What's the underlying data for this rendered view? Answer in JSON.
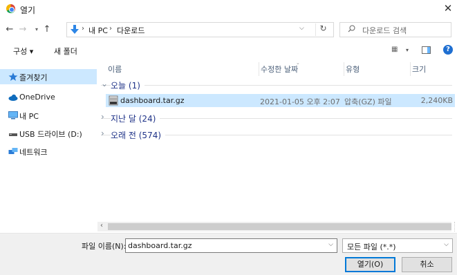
{
  "window": {
    "title": "열기",
    "close_glyph": "✕"
  },
  "nav": {
    "back": "←",
    "forward": "→",
    "recent": "▾",
    "up": "↑"
  },
  "address": {
    "crumbs": [
      "내 PC",
      "다운로드"
    ],
    "separator": "›",
    "dropdown": "⌵",
    "refresh": "↻"
  },
  "search": {
    "placeholder": "다운로드 검색"
  },
  "toolbar": {
    "organize_label": "구성 ▾",
    "new_folder_label": "새 폴더",
    "view_glyph": "▦",
    "view_dropdown": "▾",
    "help_glyph": "?"
  },
  "sidebar": {
    "items": [
      {
        "label": "즐겨찾기",
        "icon": "star-icon",
        "selected": true
      },
      {
        "label": "OneDrive",
        "icon": "cloud-icon"
      },
      {
        "label": "내 PC",
        "icon": "computer-icon"
      },
      {
        "label": "USB 드라이브 (D:)",
        "icon": "usb-drive-icon"
      },
      {
        "label": "네트워크",
        "icon": "network-icon"
      }
    ]
  },
  "columns": {
    "name": "이름",
    "date": "수정한 날짜",
    "type": "유형",
    "size": "크기",
    "sort_glyph": "⌄"
  },
  "groups": [
    {
      "label": "오늘 (1)",
      "expanded": true,
      "chevron": "⌄"
    },
    {
      "label": "지난 달 (24)",
      "expanded": false,
      "chevron": "›"
    },
    {
      "label": "오래 전 (574)",
      "expanded": false,
      "chevron": "›"
    }
  ],
  "files": [
    {
      "name": "dashboard.tar.gz",
      "date": "2021-01-05 오후 2:07",
      "type": "압축(GZ) 파일",
      "size": "2,240KB",
      "icon": "archive-icon"
    }
  ],
  "scrollbar": {
    "left_arrow": "‹"
  },
  "bottom": {
    "filename_label": "파일 이름(N):",
    "filename_value": "dashboard.tar.gz",
    "dropdown_glyph": "⌵",
    "filter_value": "모든 파일 (*.*)",
    "open_label": "열기(O)",
    "cancel_label": "취소"
  },
  "colors": {
    "selection": "#cce8ff",
    "accent": "#0078d7",
    "group_text": "#1e3287",
    "help": "#1f6fd1"
  }
}
